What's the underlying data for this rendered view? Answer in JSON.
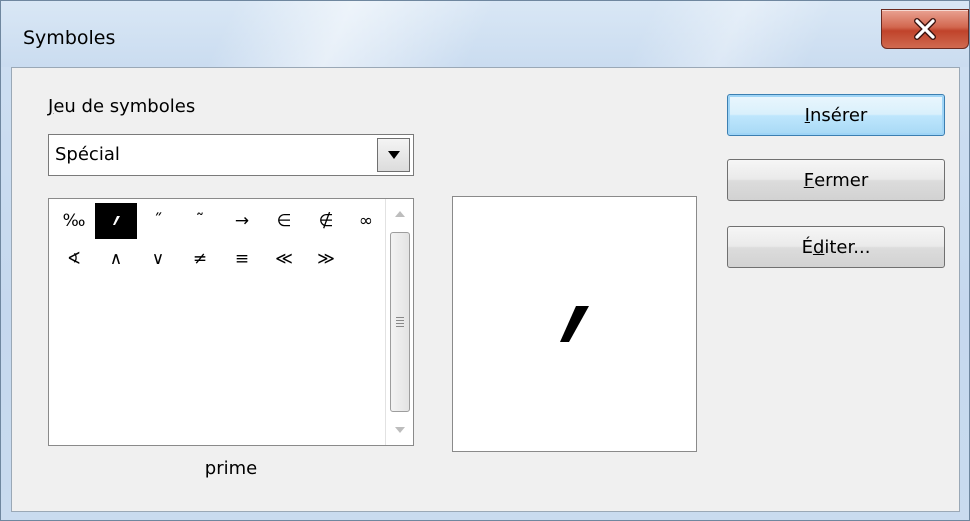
{
  "window": {
    "title": "Symboles",
    "close_icon": "close-x-icon"
  },
  "symbol_set": {
    "label_accel": "J",
    "label_rest": "eu de symboles",
    "selected": "Spécial",
    "dropdown_icon": "triangle-down-icon"
  },
  "symbols": {
    "row1": [
      "‰",
      "′",
      "˝",
      "˜",
      "→",
      "∈",
      "∉",
      "∞"
    ],
    "row2": [
      "∢",
      "∧",
      "∨",
      "≠",
      "≡",
      "≪",
      "≫"
    ],
    "selected_index": 1,
    "selected_name": "prime"
  },
  "preview": {
    "glyph": "′"
  },
  "buttons": {
    "insert": {
      "accel": "I",
      "rest": "nsérer"
    },
    "close": {
      "accel": "F",
      "rest": "ermer"
    },
    "edit": {
      "pre": "É",
      "accel": "d",
      "rest": "iter..."
    }
  }
}
